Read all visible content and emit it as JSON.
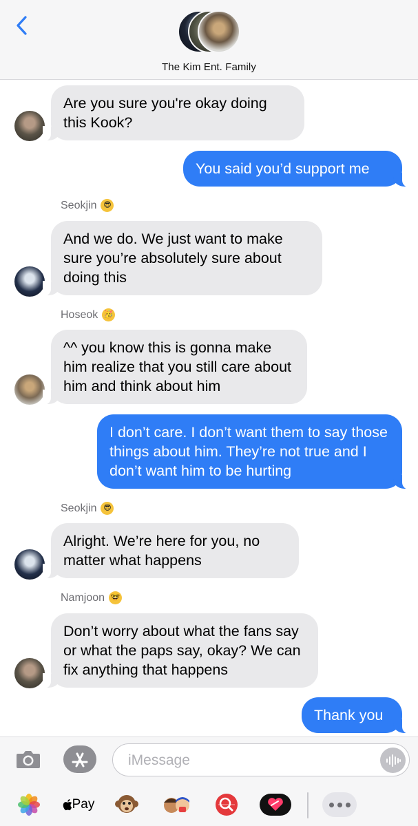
{
  "header": {
    "group_name": "The Kim Ent. Family"
  },
  "messages": [
    {
      "direction": "in",
      "sender": "",
      "sender_emoji": "",
      "text": "Are you sure you're okay doing this Kook?"
    },
    {
      "direction": "out",
      "text": "You said you’d support me"
    },
    {
      "direction": "in",
      "sender": "Seokjin",
      "sender_emoji": "😎",
      "text": "And we do. We just want to make sure you’re absolutely sure about doing this"
    },
    {
      "direction": "in",
      "sender": "Hoseok",
      "sender_emoji": "🥳",
      "text": "^^ you know this is gonna make him realize that you still care about him and think about him"
    },
    {
      "direction": "out",
      "text": "I don’t care. I don’t want them to say those things about him. They’re not true and I don’t want him to be hurting"
    },
    {
      "direction": "in",
      "sender": "Seokjin",
      "sender_emoji": "😎",
      "text": "Alright. We’re here for you, no matter what happens"
    },
    {
      "direction": "in",
      "sender": "Namjoon",
      "sender_emoji": "🤓",
      "text": "Don’t worry about what the fans say or what the paps say, okay? We can fix anything that happens"
    },
    {
      "direction": "out",
      "text": "Thank you"
    }
  ],
  "input": {
    "placeholder": "iMessage"
  },
  "tray": {
    "apple_pay_label": "Pay"
  },
  "colors": {
    "outgoing_bubble": "#2f7df6",
    "incoming_bubble": "#e9e9eb",
    "accent": "#2f7df6"
  },
  "icons": [
    "chevron-left-icon",
    "camera-icon",
    "app-store-icon",
    "audio-waveform-icon",
    "photos-icon",
    "apple-pay-icon",
    "animoji-monkey-icon",
    "memoji-icon",
    "images-search-icon",
    "digital-touch-icon",
    "more-icon"
  ]
}
